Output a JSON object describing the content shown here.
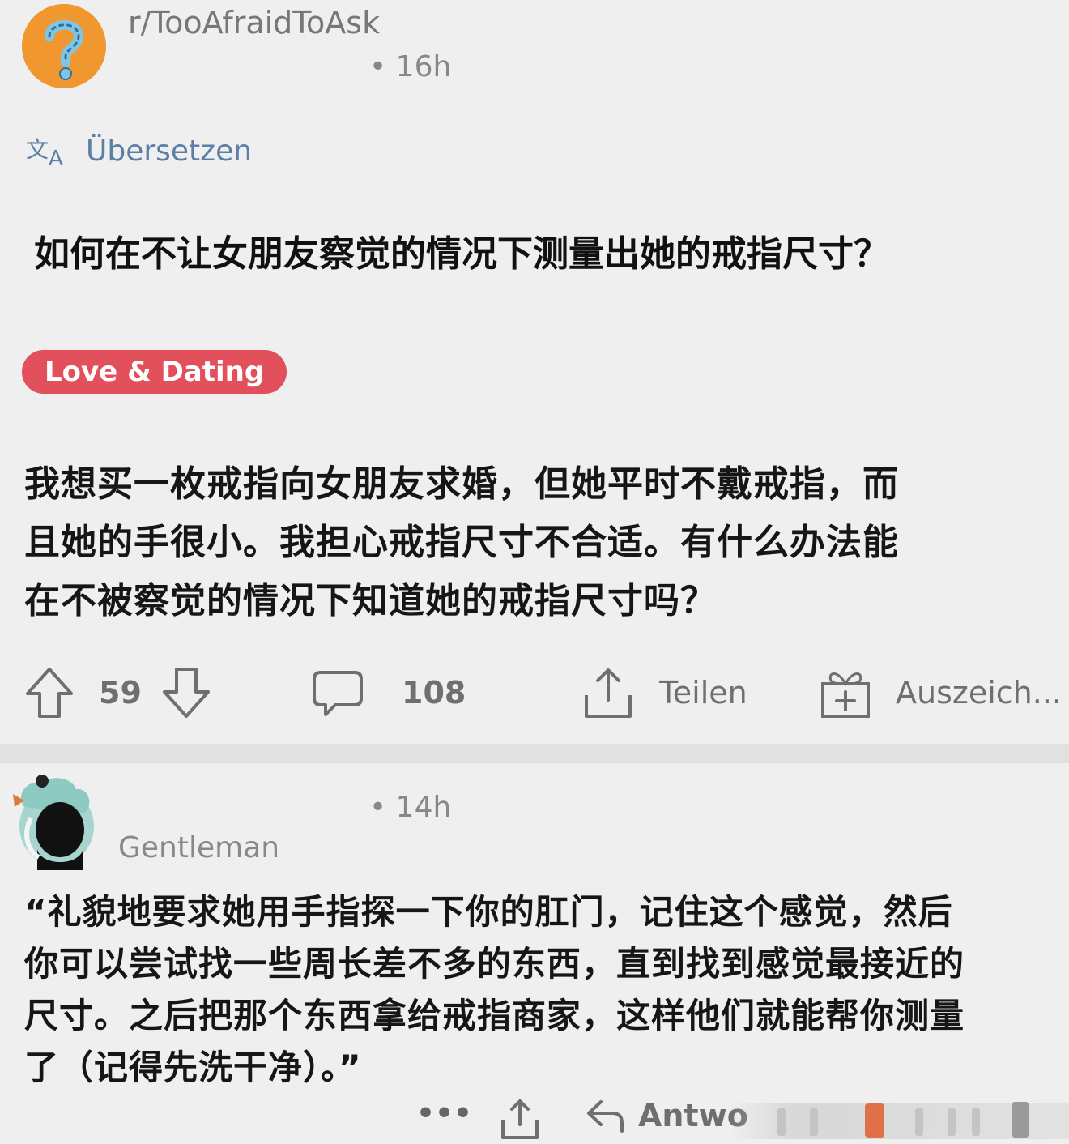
{
  "post": {
    "subreddit": "r/TooAfraidToAsk",
    "time": "• 16h",
    "translate_label": "Übersetzen",
    "title": "如何在不让女朋友察觉的情况下测量出她的戒指尺寸？",
    "flair": "Love & Dating",
    "body_lines": [
      "我想买一枚戒指向女朋友求婚，但她平时不戴戒指，而",
      "且她的手很小。我担心戒指尺寸不合适。有什么办法能",
      "在不被察觉的情况下知道她的戒指尺寸吗？"
    ],
    "actions": {
      "upvotes": "59",
      "comments": "108",
      "share_label": "Teilen",
      "award_label": "Auszeich..."
    }
  },
  "comment": {
    "time": "• 14h",
    "author": "Gentleman",
    "body_lines": [
      "“礼貌地要求她用手指探一下你的肛门，记住这个感觉，然后",
      "你可以尝试找一些周长差不多的东西，直到找到感觉最接近的",
      "尺寸。之后把那个东西拿给戒指商家，这样他们就能帮你测量",
      "了（记得先洗干净）。”"
    ],
    "actions": {
      "more": "•••",
      "reply_label": "Antwo"
    }
  },
  "colors": {
    "flair_bg": "#e1505b",
    "translate_link": "#5b7fa6",
    "subreddit_avatar": "#f0982f"
  }
}
